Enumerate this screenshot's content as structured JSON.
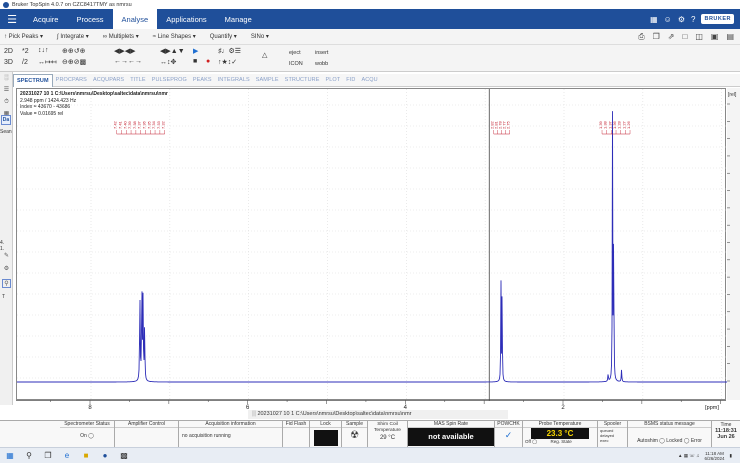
{
  "window": {
    "title": "Bruker TopSpin 4.0.7 on CZC8417TMY as nmrsu"
  },
  "menubar": {
    "items": [
      "Acquire",
      "Process",
      "Analyse",
      "Applications",
      "Manage"
    ],
    "active": "Analyse",
    "brand": "BRUKER"
  },
  "ribbon1": {
    "items": [
      "Pick Peaks",
      "Integrate",
      "Multiplets",
      "Line Shapes",
      "Quantify",
      "SINo"
    ]
  },
  "ribbon2": {
    "dim2d": "2D",
    "dim3d": "3D",
    "n1": "*2",
    "n2": "/2",
    "eject": "eject",
    "insert": "insert",
    "icon": "ICON",
    "wobb": "wobb"
  },
  "left_bar": {
    "sean": "Sean",
    "da": "Da",
    "n1": "4.",
    "n2": "1.",
    "t": "T"
  },
  "tabs": [
    "SPECTRUM",
    "PROCPARS",
    "ACQUPARS",
    "TITLE",
    "PULSEPROG",
    "PEAKS",
    "INTEGRALS",
    "SAMPLE",
    "STRUCTURE",
    "PLOT",
    "FID",
    "ACQU"
  ],
  "active_tab": "SPECTRUM",
  "spectrum": {
    "dataset": "20231027  10  1  C:\\Users\\nmrsu\\Desktop\\saltec\\data\\nmrsu\\nmr",
    "cursor_ppm": "2.948 ppm / 1424.423 Hz",
    "cursor_index": "Index = 43670 - 43686",
    "cursor_value": "Value = 0.01695    rel",
    "unit_label": "[rel]",
    "x_unit": "[ppm]",
    "x_ticks": [
      "8",
      "6",
      "4",
      "2"
    ],
    "y_ticks": [
      "1.6",
      "1.5",
      "1.4",
      "1.3",
      "1.2",
      "1.1",
      "1.0",
      "0.9",
      "0.8",
      "0.7",
      "0.6",
      "0.5",
      "0.4",
      "0.3",
      "0.2",
      "0.1",
      "0.0"
    ]
  },
  "peaks": {
    "group1": [
      "7.42",
      "7.41",
      "7.40",
      "7.39",
      "7.38",
      "7.37",
      "7.36",
      "7.35",
      "7.34",
      "7.33",
      "7.32"
    ],
    "group2": [
      "2.82",
      "2.81",
      "2.78",
      "2.77",
      "2.75"
    ],
    "group3": [
      "1.39",
      "1.38",
      "1.37",
      "1.36",
      "1.28",
      "1.27",
      "1.26"
    ]
  },
  "pathbar": {
    "text": "20231027  10  1  C:\\Users\\nmrsu\\Desktop\\saltec\\data\\nmrsu\\nmr"
  },
  "statusbar": {
    "spectrometer_status": "Spectrometer Status",
    "on": "On",
    "amplifier_control": "Amplifier Control",
    "acquisition_information": "Acquisition information",
    "acq_value": "no acquisition running",
    "fid_flash": "Fid Flash",
    "lock": "Lock",
    "sample": "Sample",
    "shim_coil": "Shim Coil Temperature",
    "shim_value": "29 °C",
    "mas_spin_rate": "MAS Spin Rate",
    "mas_value": "not available",
    "powchk": "POWCHK",
    "probe_temperature": "Probe Temperature",
    "probe_value": "23.3 °C",
    "off": "Off",
    "reg_state": "Reg. State",
    "spooler": "Spooler",
    "queued": "queued",
    "delayed": "delayed",
    "exec": "exec",
    "bsms_status": "BSMS status message",
    "autoshim": "Autoshim",
    "locked": "Locked",
    "error": "Error",
    "time_label": "Time",
    "time": "11:18:31",
    "date": "Jun 26"
  },
  "taskbar": {
    "time": "11:18 AM",
    "date": "6/26/2024"
  },
  "colors": {
    "brand": "#1f4f9a",
    "spectrum": "#2d2db8",
    "peaklabel": "#c0182a",
    "probe": "#f7d600"
  }
}
